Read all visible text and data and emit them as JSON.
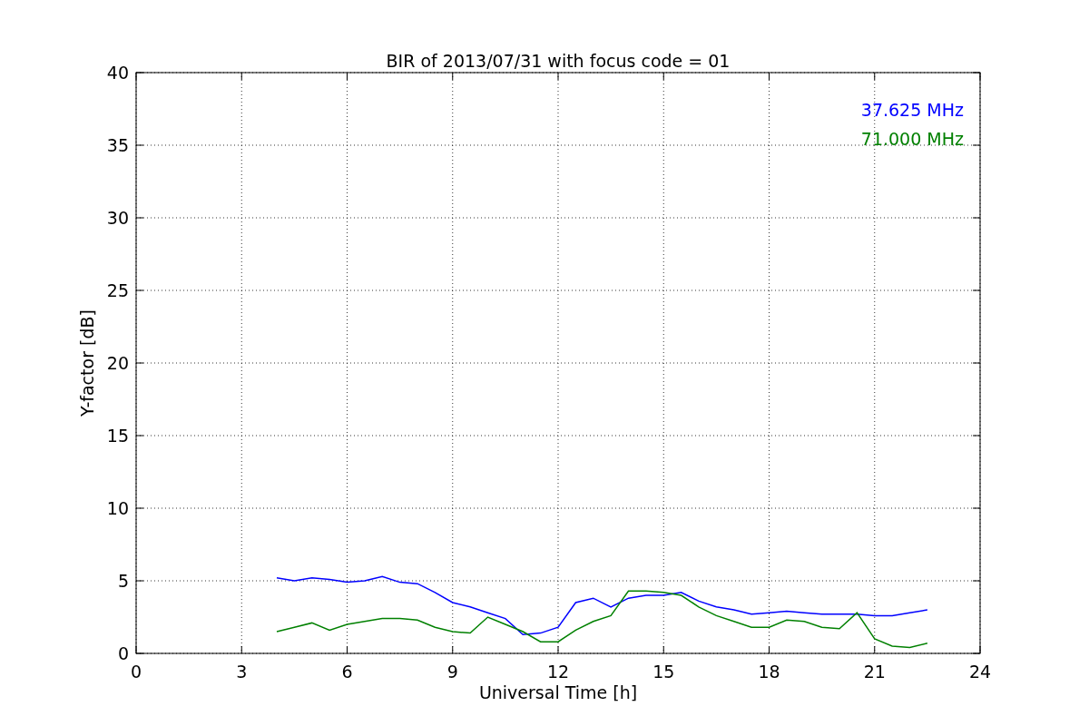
{
  "chart_data": {
    "type": "line",
    "title": "BIR of 2013/07/31 with focus code = 01",
    "xlabel": "Universal Time [h]",
    "ylabel": "Y-factor [dB]",
    "x": [
      4.0,
      4.5,
      5.0,
      5.5,
      6.0,
      6.5,
      7.0,
      7.5,
      8.0,
      8.5,
      9.0,
      9.5,
      10.0,
      10.5,
      11.0,
      11.5,
      12.0,
      12.5,
      13.0,
      13.5,
      14.0,
      14.5,
      15.0,
      15.5,
      16.0,
      16.5,
      17.0,
      17.5,
      18.0,
      18.5,
      19.0,
      19.5,
      20.0,
      20.5,
      21.0,
      21.5,
      22.0,
      22.5
    ],
    "series": [
      {
        "name": "37.625 MHz",
        "color": "#0000ff",
        "values": [
          5.2,
          5.0,
          5.2,
          5.1,
          4.9,
          5.0,
          5.3,
          4.9,
          4.8,
          4.2,
          3.5,
          3.2,
          2.8,
          2.4,
          1.3,
          1.4,
          1.8,
          3.5,
          3.8,
          3.2,
          3.8,
          4.0,
          4.0,
          4.2,
          3.6,
          3.2,
          3.0,
          2.7,
          2.8,
          2.9,
          2.8,
          2.7,
          2.7,
          2.7,
          2.6,
          2.6,
          2.8,
          3.0
        ]
      },
      {
        "name": "71.000 MHz",
        "color": "#008000",
        "values": [
          1.5,
          1.8,
          2.1,
          1.6,
          2.0,
          2.2,
          2.4,
          2.4,
          2.3,
          1.8,
          1.5,
          1.4,
          2.5,
          2.0,
          1.5,
          0.8,
          0.8,
          1.6,
          2.2,
          2.6,
          4.3,
          4.3,
          4.2,
          4.0,
          3.2,
          2.6,
          2.2,
          1.8,
          1.8,
          2.3,
          2.2,
          1.8,
          1.7,
          2.8,
          1.0,
          0.5,
          0.4,
          0.7
        ]
      }
    ],
    "grid": true,
    "xlim": [
      0,
      24
    ],
    "ylim": [
      0,
      40
    ],
    "xticks": [
      0,
      3,
      6,
      9,
      12,
      15,
      18,
      21,
      24
    ],
    "yticks": [
      0,
      5,
      10,
      15,
      20,
      25,
      30,
      35,
      40
    ]
  }
}
